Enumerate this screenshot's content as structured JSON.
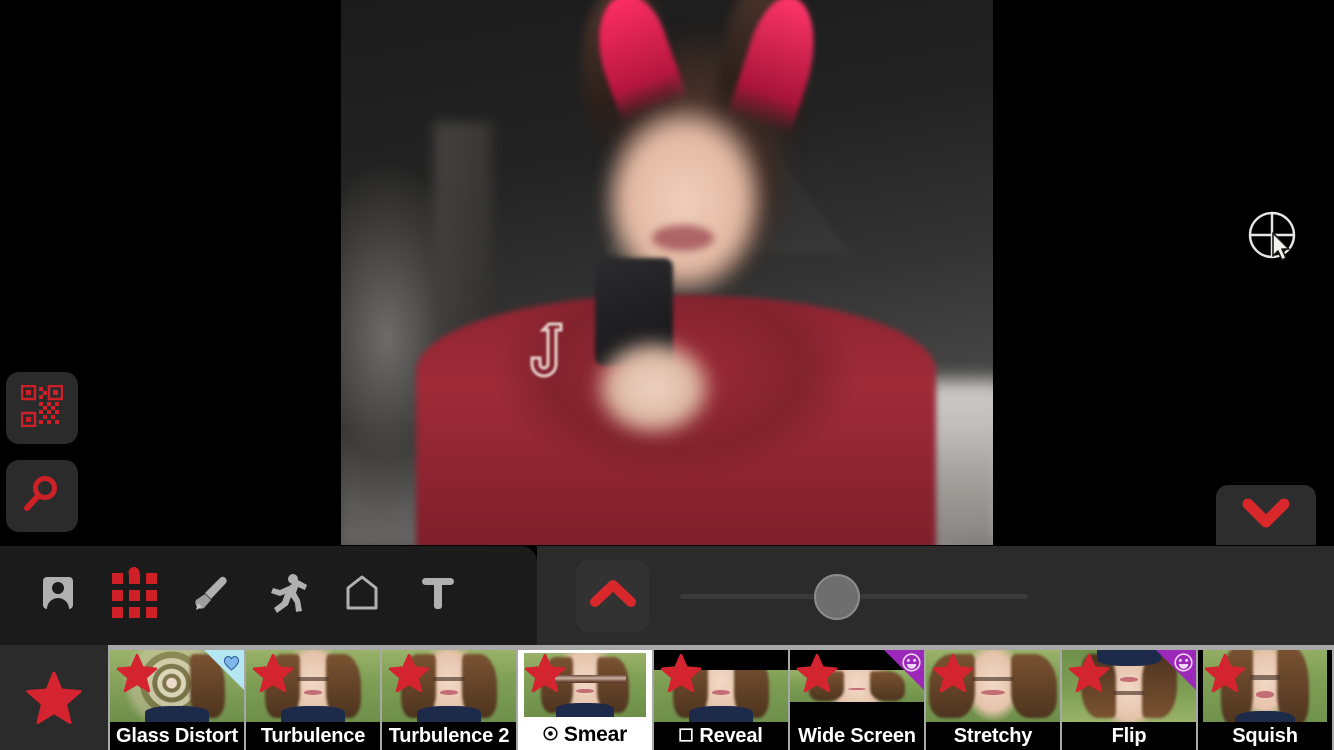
{
  "app": {
    "name": "video-effects-editor",
    "accent_red": "#cf2027",
    "toolbar_bg": "#2b2b2b",
    "panel_bg": "#1b1b1b",
    "filmstrip_bg": "#a8a8a8"
  },
  "preview": {
    "name": "video-preview",
    "description": "Distorted selfie video frame with effect applied"
  },
  "overlay": {
    "qr_icon": "qr-code-icon",
    "search_icon": "search-icon",
    "target_cursor_icon": "target-cursor-icon",
    "collapse_icon": "chevron-down-icon"
  },
  "toolbar": {
    "tools": [
      {
        "name": "portrait-tool",
        "icon": "portrait-icon",
        "active": false
      },
      {
        "name": "effects-grid-tool",
        "icon": "grid-dots-icon",
        "active": true
      },
      {
        "name": "brush-tool",
        "icon": "paintbrush-icon",
        "active": false
      },
      {
        "name": "motion-tool",
        "icon": "running-person-icon",
        "active": false
      },
      {
        "name": "frame-tool",
        "icon": "frame-icon",
        "active": false
      },
      {
        "name": "text-tool",
        "icon": "text-t-icon",
        "active": false
      }
    ],
    "expand_button": {
      "name": "expand-panel-button",
      "icon": "chevron-up-icon"
    },
    "slider": {
      "name": "effect-intensity-slider",
      "value_percent": 45,
      "min": 0,
      "max": 100
    }
  },
  "filmstrip": {
    "favorites_button": {
      "name": "favorites-button",
      "icon": "star-icon"
    },
    "tiles": [
      {
        "label": "Glass Distort",
        "style": "glass",
        "badge": "heart",
        "badge_color": "#b5e7f2",
        "selected": false,
        "starred": true
      },
      {
        "label": "Turbulence",
        "style": "plain",
        "badge": null,
        "selected": false,
        "starred": true
      },
      {
        "label": "Turbulence 2",
        "style": "plain",
        "badge": null,
        "selected": false,
        "starred": true
      },
      {
        "label": "Smear",
        "style": "smear",
        "badge": null,
        "selected": true,
        "starred": true,
        "prefix_icon": "record-circle-icon"
      },
      {
        "label": "Reveal",
        "style": "letterbox",
        "badge": null,
        "selected": false,
        "starred": true,
        "prefix_icon": "stop-square-icon"
      },
      {
        "label": "Wide Screen",
        "style": "widescreen",
        "badge": "face",
        "badge_color": "#9b28b8",
        "selected": false,
        "starred": true
      },
      {
        "label": "Stretchy",
        "style": "stretchy",
        "badge": null,
        "selected": false,
        "starred": true
      },
      {
        "label": "Flip",
        "style": "flip",
        "badge": "face",
        "badge_color": "#9b28b8",
        "selected": false,
        "starred": true
      },
      {
        "label": "Squish",
        "style": "squish",
        "badge": null,
        "selected": false,
        "starred": true
      },
      {
        "label": "",
        "style": "plain",
        "badge": null,
        "selected": false,
        "starred": false,
        "partial": true
      }
    ]
  }
}
